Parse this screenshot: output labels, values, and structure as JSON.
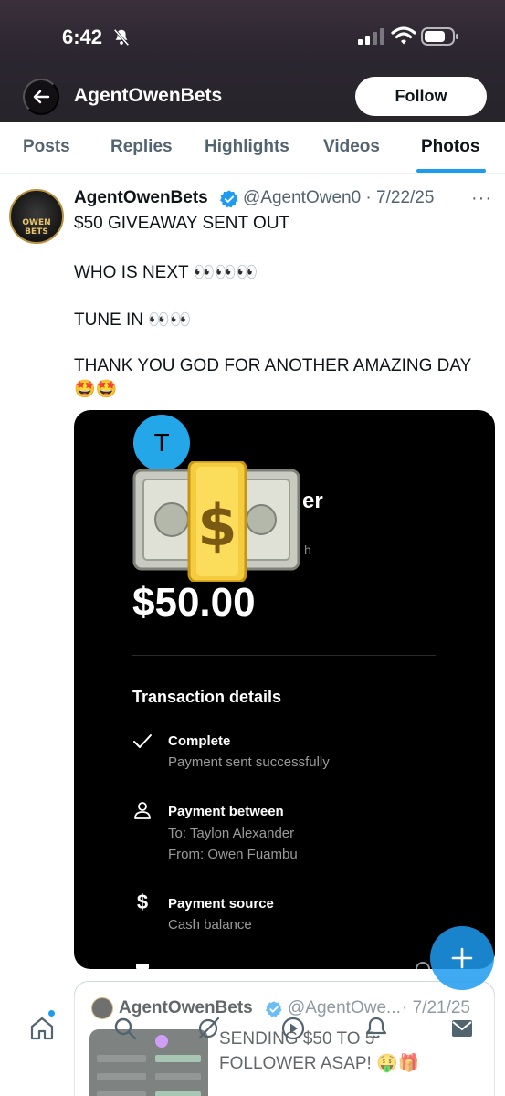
{
  "status_bar": {
    "time": "6:42"
  },
  "header": {
    "title": "AgentOwenBets",
    "follow_label": "Follow"
  },
  "tabs": [
    {
      "label": "Posts"
    },
    {
      "label": "Replies"
    },
    {
      "label": "Highlights"
    },
    {
      "label": "Videos"
    },
    {
      "label": "Photos"
    }
  ],
  "post": {
    "avatar_text": "OWEN BETS",
    "author_name": "AgentOwenBets",
    "handle_date": "@AgentOwen0 · 7/22/25",
    "lines": [
      "$50 GIVEAWAY SENT OUT",
      "WHO IS NEXT 👀👀👀",
      "TUNE IN 👀👀",
      "THANK YOU GOD FOR ANOTHER AMAZING DAY",
      "🤩🤩"
    ]
  },
  "media": {
    "avatar_letter": "T",
    "partial_title": "er",
    "partial_sub": "h",
    "amount": "$50.00",
    "heading": "Transaction details",
    "items": [
      {
        "title": "Complete",
        "lines": [
          "Payment sent successfully"
        ]
      },
      {
        "title": "Payment between",
        "lines": [
          "To: Taylon Alexander",
          "From: Owen Fuambu"
        ]
      },
      {
        "title": "Payment source",
        "lines": [
          "Cash balance"
        ]
      }
    ]
  },
  "quote": {
    "author_name": "AgentOwenBets",
    "handle": "@AgentOwe...",
    "date": "· 7/21/25",
    "lines": [
      "SENDING $50 TO 5",
      "FOLLOWER ASAP! 🤑🎁"
    ]
  },
  "colors": {
    "accent": "#1d9bf0",
    "text": "#0f1419",
    "muted": "#536471"
  }
}
